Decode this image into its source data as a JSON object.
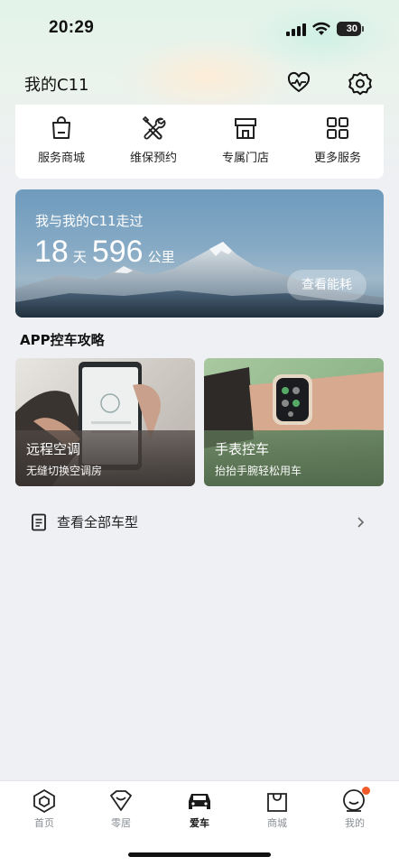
{
  "status": {
    "time": "20:29",
    "battery": "30"
  },
  "header": {
    "title": "我的C11",
    "icons": [
      "heart-pulse-icon",
      "gear-icon"
    ]
  },
  "services": [
    {
      "label": "服务商城",
      "icon": "shopping-bag-icon"
    },
    {
      "label": "维保预约",
      "icon": "wrench-icon"
    },
    {
      "label": "专属门店",
      "icon": "store-icon"
    },
    {
      "label": "更多服务",
      "icon": "grid-icon"
    }
  ],
  "banner": {
    "title": "我与我的C11走过",
    "days": "18",
    "days_unit": "天",
    "distance": "596",
    "distance_unit": "公里",
    "button": "查看能耗"
  },
  "guides": {
    "title": "APP控车攻略",
    "cards": [
      {
        "title": "远程空调",
        "subtitle": "无缝切换空调房"
      },
      {
        "title": "手表控车",
        "subtitle": "抬抬手腕轻松用车"
      }
    ]
  },
  "models_link": {
    "label": "查看全部车型",
    "icon": "document-icon"
  },
  "bottom_nav": [
    {
      "label": "首页",
      "icon": "hexagon-home-icon"
    },
    {
      "label": "零居",
      "icon": "heart-outline-icon"
    },
    {
      "label": "爱车",
      "icon": "car-icon",
      "active": true
    },
    {
      "label": "商城",
      "icon": "shopping-bag-icon"
    },
    {
      "label": "我的",
      "icon": "profile-icon",
      "badge": true
    }
  ],
  "colors": {
    "accent_badge": "#f05a28",
    "background": "#eef0f3"
  }
}
